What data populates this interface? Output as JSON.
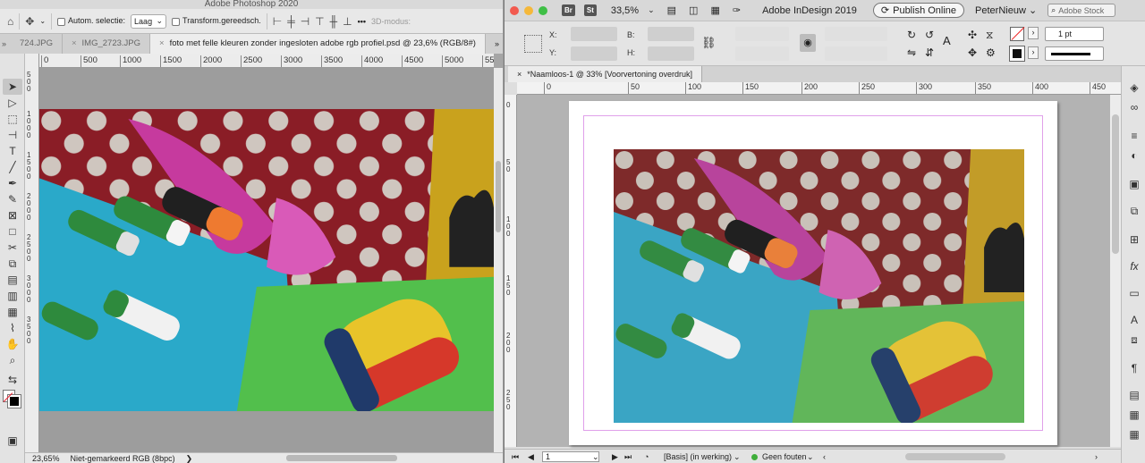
{
  "photoshop": {
    "app_title": "Adobe Photoshop 2020",
    "options": {
      "auto_select_label": "Autom. selectie:",
      "layer_select": "Laag",
      "transform_label": "Transform.gereedsch.",
      "mode_3d": "3D-modus:",
      "more": "•••"
    },
    "tabs": [
      {
        "label": "724.JPG"
      },
      {
        "label": "IMG_2723.JPG"
      },
      {
        "label": "foto met felle kleuren zonder ingesloten adobe rgb profiel.psd @ 23,6% (RGB/8#)"
      }
    ],
    "ruler_h": [
      "0",
      "500",
      "1000",
      "1500",
      "2000",
      "2500",
      "3000",
      "3500",
      "4000",
      "4500",
      "5000",
      "55"
    ],
    "ruler_v": [
      "500",
      "1000",
      "1500",
      "2000",
      "2500",
      "3000",
      "3500"
    ],
    "status": {
      "zoom": "23,65%",
      "profile": "Niet-gemarkeerd RGB (8bpc)",
      "arrow": "❯"
    }
  },
  "indesign": {
    "app_title": "Adobe InDesign 2019",
    "zoom": "33,5%",
    "badges": {
      "br": "Br",
      "st": "St"
    },
    "publish_label": "Publish Online",
    "user": "PeterNieuw",
    "search_placeholder": "Adobe Stock",
    "fields": {
      "x": "X:",
      "y": "Y:",
      "b": "B:",
      "h": "H:"
    },
    "stroke_weight": "1 pt",
    "doc_tab": "*Naamloos-1 @ 33% [Voorvertoning overdruk]",
    "ruler_h": [
      "0",
      "50",
      "100",
      "150",
      "200",
      "250",
      "300",
      "350",
      "400",
      "450"
    ],
    "ruler_v": [
      "0",
      "50",
      "100",
      "150",
      "200",
      "250"
    ],
    "status": {
      "page": "1",
      "master": "[Basis] (in werking)",
      "preflight": "Geen fouten"
    }
  },
  "colors": {
    "preflight_ok": "#3fae3a",
    "margin": "#e0a0ea"
  }
}
